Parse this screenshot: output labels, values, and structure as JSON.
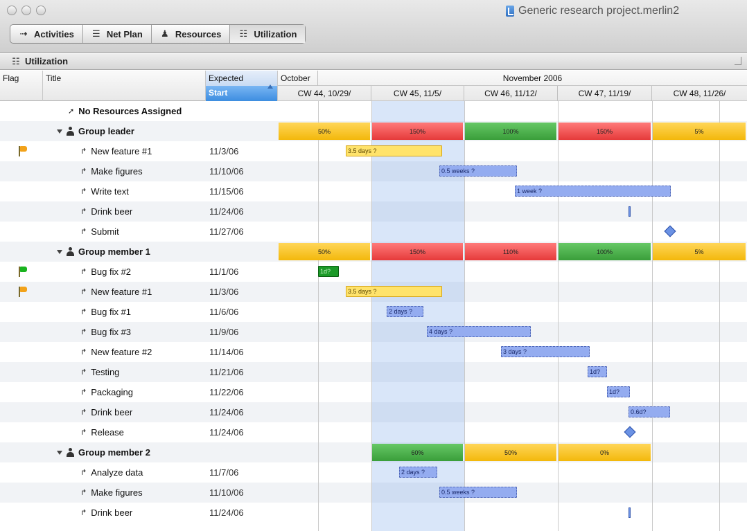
{
  "window": {
    "title": "Generic research project.merlin2"
  },
  "toolbar": {
    "tabs": [
      {
        "label": "Activities",
        "icon": "activities-icon",
        "glyph": "⇢"
      },
      {
        "label": "Net Plan",
        "icon": "netplan-icon",
        "glyph": "☰"
      },
      {
        "label": "Resources",
        "icon": "resources-icon",
        "glyph": "♟"
      },
      {
        "label": "Utilization",
        "icon": "utilization-icon",
        "glyph": "☷"
      }
    ]
  },
  "panel": {
    "title": "Utilization"
  },
  "columns": {
    "flag": "Flag",
    "title": "Title",
    "start_line1": "Expected",
    "start_line2": "Start"
  },
  "timeline": {
    "months": [
      "October",
      "November 2006"
    ],
    "weeks": [
      "CW 44, 10/29/",
      "CW 45, 11/5/",
      "CW 46, 11/12/",
      "CW 47, 11/19/",
      "CW 48, 11/26/"
    ]
  },
  "rows": [
    {
      "type": "group",
      "title": "No Resources Assigned",
      "start": "",
      "flag": null
    },
    {
      "type": "group",
      "title": "Group leader",
      "start": "",
      "flag": null,
      "util": [
        "50%",
        "150%",
        "100%",
        "150%",
        "5%"
      ]
    },
    {
      "type": "task",
      "title": "New feature #1",
      "start": "11/3/06",
      "flag": "orange",
      "bar": {
        "label": "3.5 days ?",
        "style": "y"
      }
    },
    {
      "type": "task",
      "title": "Make figures",
      "start": "11/10/06",
      "flag": null,
      "bar": {
        "label": "0.5 weeks ?",
        "style": "b"
      }
    },
    {
      "type": "task",
      "title": "Write text",
      "start": "11/15/06",
      "flag": null,
      "bar": {
        "label": "1 week ?",
        "style": "b"
      }
    },
    {
      "type": "task",
      "title": "Drink beer",
      "start": "11/24/06",
      "flag": null,
      "bar": {
        "label": "",
        "style": "tick"
      }
    },
    {
      "type": "task",
      "title": "Submit",
      "start": "11/27/06",
      "flag": null,
      "bar": {
        "label": "",
        "style": "milestone"
      }
    },
    {
      "type": "group",
      "title": "Group member 1",
      "start": "",
      "flag": null,
      "util": [
        "50%",
        "150%",
        "110%",
        "100%",
        "5%"
      ]
    },
    {
      "type": "task",
      "title": "Bug fix #2",
      "start": "11/1/06",
      "flag": "green",
      "bar": {
        "label": "1d?",
        "style": "g"
      }
    },
    {
      "type": "task",
      "title": "New feature #1",
      "start": "11/3/06",
      "flag": "orange",
      "bar": {
        "label": "3.5 days ?",
        "style": "y"
      }
    },
    {
      "type": "task",
      "title": "Bug fix #1",
      "start": "11/6/06",
      "flag": null,
      "bar": {
        "label": "2 days ?",
        "style": "b"
      }
    },
    {
      "type": "task",
      "title": "Bug fix #3",
      "start": "11/9/06",
      "flag": null,
      "bar": {
        "label": "4 days ?",
        "style": "b"
      }
    },
    {
      "type": "task",
      "title": "New feature #2",
      "start": "11/14/06",
      "flag": null,
      "bar": {
        "label": "3 days ?",
        "style": "b"
      }
    },
    {
      "type": "task",
      "title": "Testing",
      "start": "11/21/06",
      "flag": null,
      "bar": {
        "label": "1d?",
        "style": "b"
      }
    },
    {
      "type": "task",
      "title": "Packaging",
      "start": "11/22/06",
      "flag": null,
      "bar": {
        "label": "1d?",
        "style": "b"
      }
    },
    {
      "type": "task",
      "title": "Drink beer",
      "start": "11/24/06",
      "flag": null,
      "bar": {
        "label": "0.6d?",
        "style": "b"
      }
    },
    {
      "type": "task",
      "title": "Release",
      "start": "11/24/06",
      "flag": null,
      "bar": {
        "label": "",
        "style": "milestone"
      }
    },
    {
      "type": "group",
      "title": "Group member 2",
      "start": "",
      "flag": null,
      "util": [
        "",
        "60%",
        "50%",
        "0%",
        ""
      ]
    },
    {
      "type": "task",
      "title": "Analyze data",
      "start": "11/7/06",
      "flag": null,
      "bar": {
        "label": "2 days ?",
        "style": "b"
      }
    },
    {
      "type": "task",
      "title": "Make figures",
      "start": "11/10/06",
      "flag": null,
      "bar": {
        "label": "0.5 weeks ?",
        "style": "b"
      }
    },
    {
      "type": "task",
      "title": "Drink beer",
      "start": "11/24/06",
      "flag": null,
      "bar": {
        "label": "",
        "style": "tick"
      }
    }
  ],
  "colors": {
    "util_ok": "#3a9e3a",
    "util_over": "#e63a3a",
    "util_low": "#f3b80b",
    "task_bar": "#94acf0",
    "current_week": "#78a5eb"
  }
}
